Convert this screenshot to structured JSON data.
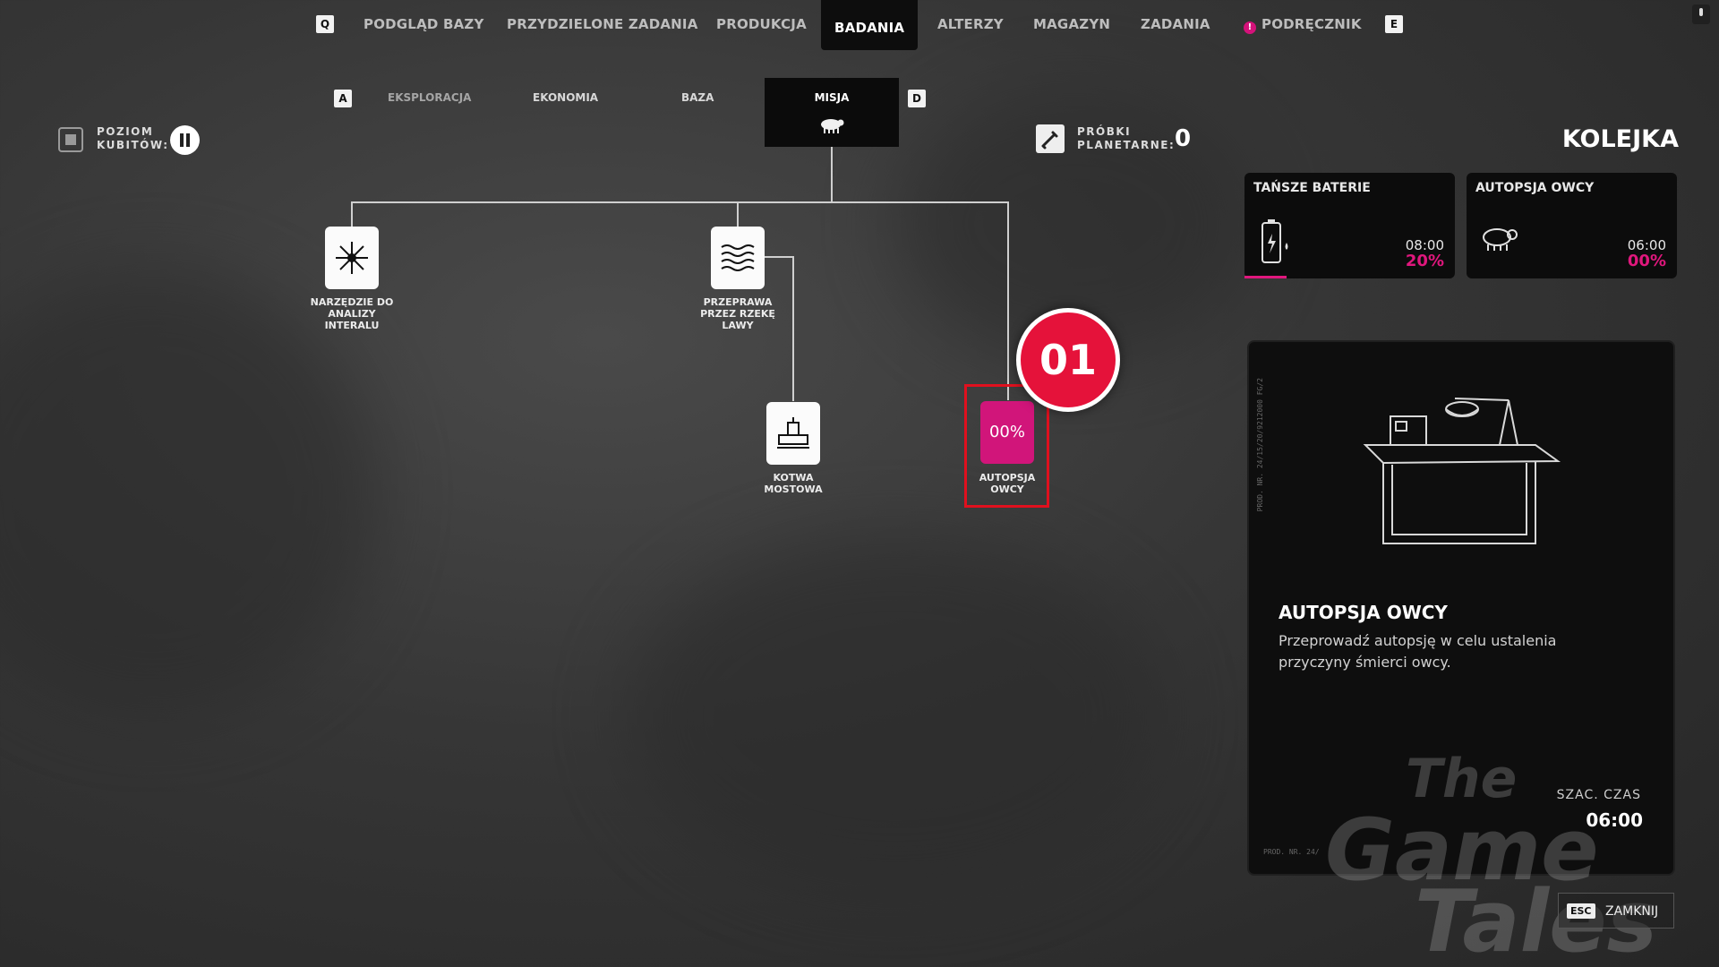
{
  "topnav": {
    "left_key": "Q",
    "right_key": "E",
    "items": [
      "PODGLĄD BAZY",
      "PRZYDZIELONE ZADANIA",
      "PRODUKCJA",
      "BADANIA",
      "ALTERZY",
      "MAGAZYN",
      "ZADANIA",
      "PODRĘCZNIK"
    ],
    "active": "BADANIA"
  },
  "subnav": {
    "left_key": "A",
    "right_key": "D",
    "items": [
      "EKSPLORACJA",
      "EKONOMIA",
      "BAZA",
      "MISJA"
    ],
    "active": "MISJA"
  },
  "qubit_level": {
    "label_line1": "POZIOM",
    "label_line2": "KUBITÓW:"
  },
  "samples": {
    "label_line1": "PRÓBKI",
    "label_line2": "PLANETARNE:",
    "value": "0"
  },
  "tree": {
    "nodes": [
      {
        "label_lines": [
          "NARZĘDZIE DO",
          "ANALIZY",
          "INTERALU"
        ],
        "icon": "star-burst-icon"
      },
      {
        "label_lines": [
          "PRZEPRAWA",
          "PRZEZ RZEKĘ",
          "LAWY"
        ],
        "icon": "lava-waves-icon"
      },
      {
        "label_lines": [
          "KOTWA",
          "MOSTOWA"
        ],
        "icon": "bridge-anchor-icon"
      },
      {
        "label_lines": [
          "AUTOPSJA",
          "OWCY"
        ],
        "icon": "sheep-icon",
        "progress": "00%",
        "selected": true
      }
    ],
    "accent_color": "#d1157a"
  },
  "step_badge": "01",
  "queue": {
    "title": "KOLEJKA",
    "items": [
      {
        "name": "TAŃSZE BATERIE",
        "time": "08:00",
        "progress": "20%",
        "icon": "battery-icon"
      },
      {
        "name": "AUTOPSJA OWCY",
        "time": "06:00",
        "progress": "00%",
        "icon": "sheep-icon"
      }
    ]
  },
  "detail": {
    "title": "AUTOPSJA OWCY",
    "description": "Przeprowadź autopsję w celu ustalenia przyczyny śmierci owcy.",
    "est_label": "SZAC. CZAS",
    "est_time": "06:00",
    "side_text": "PROD. NR. 24/15/20/9212000 FG/2",
    "prod_text": "PROD. NR. 24/"
  },
  "watermark": [
    "The",
    "Game",
    "Tales"
  ],
  "close": {
    "key": "ESC",
    "label": "ZAMKNIJ"
  }
}
